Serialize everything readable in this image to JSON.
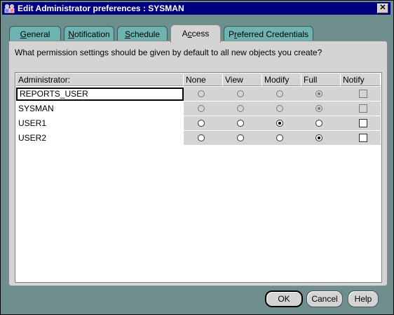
{
  "window": {
    "title": "Edit Administrator preferences : SYSMAN",
    "close_glyph": "✕",
    "icon": "administrator-app-icon"
  },
  "tabs": [
    {
      "label": "General",
      "mnemonic": "G",
      "active": false
    },
    {
      "label": "Notification",
      "mnemonic": "N",
      "active": false
    },
    {
      "label": "Schedule",
      "mnemonic": "S",
      "active": false
    },
    {
      "label": "Access",
      "mnemonic": "c",
      "active": true
    },
    {
      "label": "Preferred Credentials",
      "mnemonic": "r",
      "active": false
    }
  ],
  "access": {
    "question": "What permission settings should be given by default to all new objects you create?",
    "columns": [
      "Administrator:",
      "None",
      "View",
      "Modify",
      "Full",
      "Notify"
    ],
    "rows": [
      {
        "name": "REPORTS_USER",
        "selected": true,
        "enabled": false,
        "permission": "Full",
        "notify": false
      },
      {
        "name": "SYSMAN",
        "selected": false,
        "enabled": false,
        "permission": "Full",
        "notify": false
      },
      {
        "name": "USER1",
        "selected": false,
        "enabled": true,
        "permission": "Modify",
        "notify": false
      },
      {
        "name": "USER2",
        "selected": false,
        "enabled": true,
        "permission": "Full",
        "notify": false
      }
    ]
  },
  "buttons": {
    "ok": "OK",
    "cancel": "Cancel",
    "help": "Help"
  },
  "colors": {
    "titlebar": "#000080",
    "dialog_frame": "#6f8f8f",
    "tab_inactive": "#6fb2b2",
    "panel": "#d4d4d4"
  }
}
